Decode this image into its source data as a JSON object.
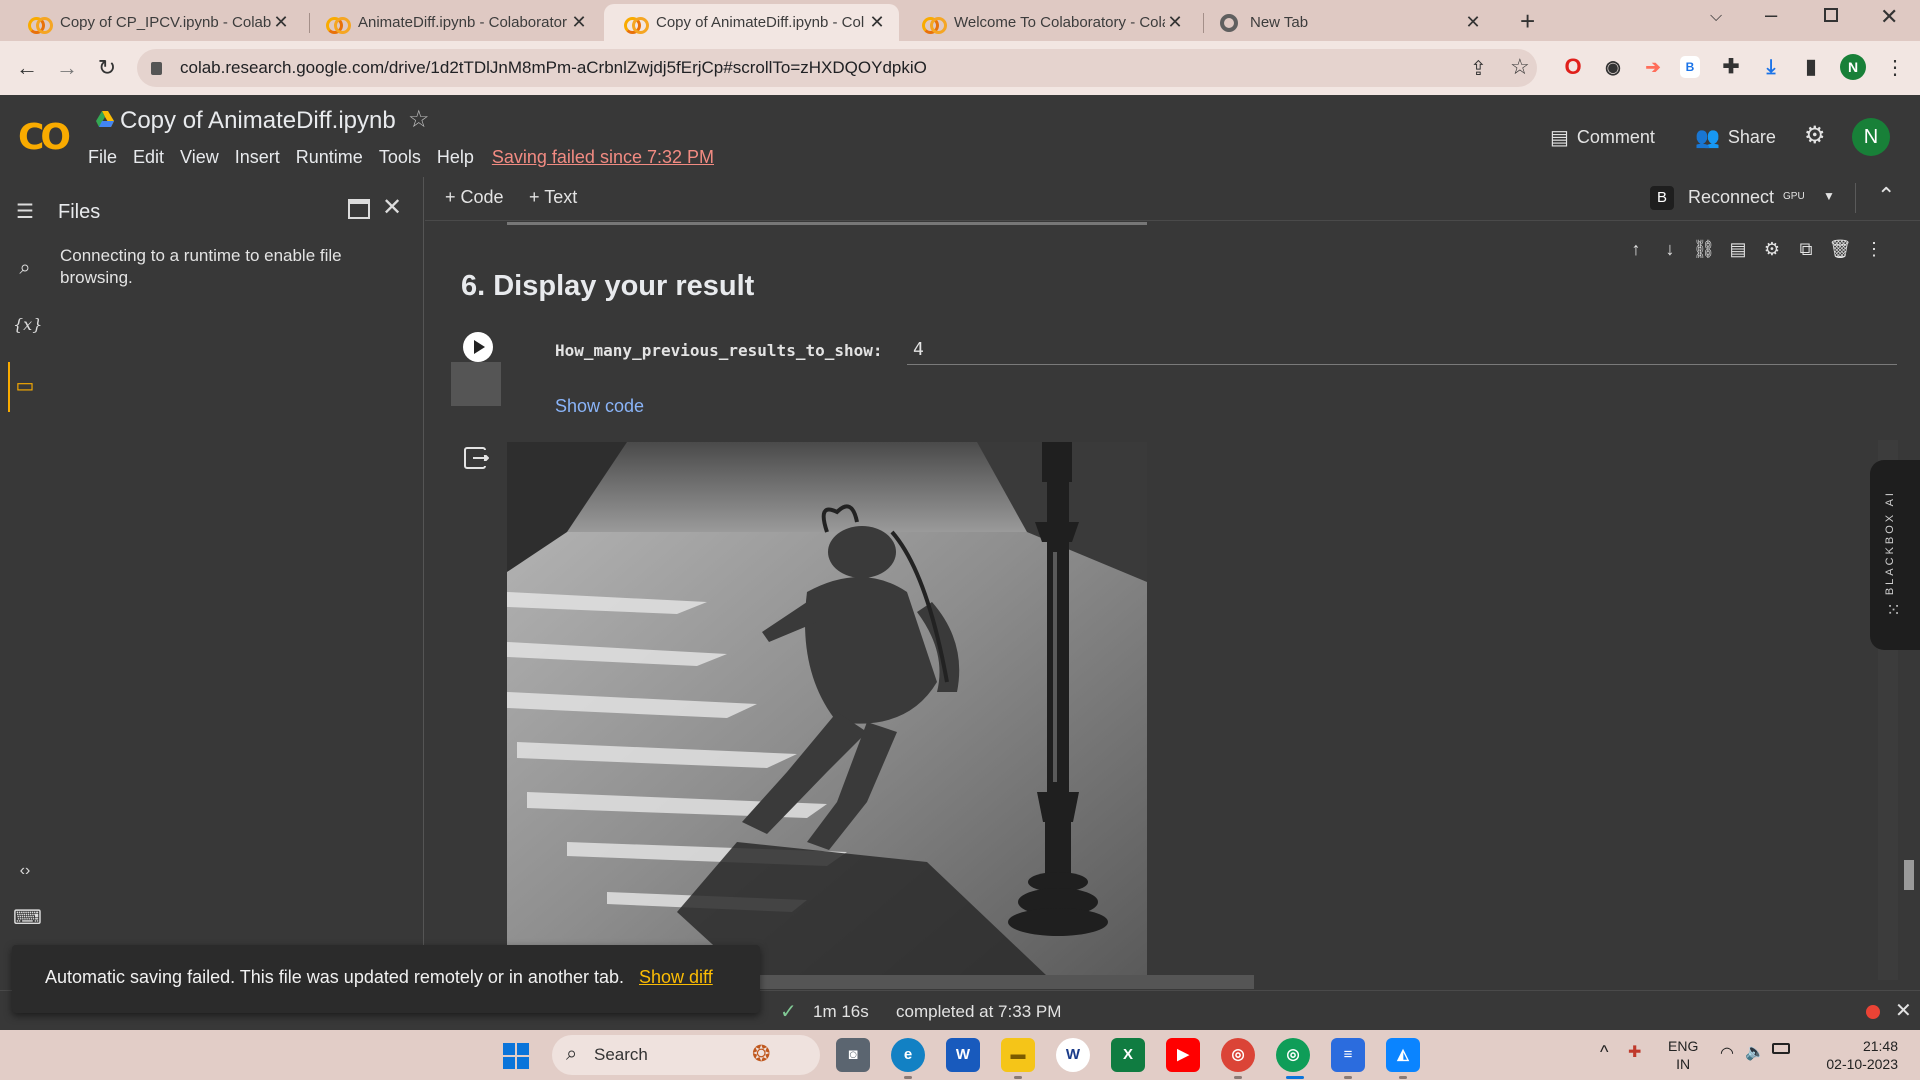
{
  "browser": {
    "tabs": [
      {
        "title": "Copy of CP_IPCV.ipynb - Colabo",
        "active": false
      },
      {
        "title": "AnimateDiff.ipynb - Colaborator",
        "active": false
      },
      {
        "title": "Copy of AnimateDiff.ipynb - Col",
        "active": true
      },
      {
        "title": "Welcome To Colaboratory - Cola",
        "active": false
      },
      {
        "title": "New Tab",
        "active": false
      }
    ],
    "url": "colab.research.google.com/drive/1d2tTDlJnM8mPm-aCrbnlZwjdj5fErjCp#scrollTo=zHXDQOYdpkiO",
    "profile_initial": "N"
  },
  "colab": {
    "logo_text": "CO",
    "notebook_title": "Copy of AnimateDiff.ipynb",
    "menu": [
      "File",
      "Edit",
      "View",
      "Insert",
      "Runtime",
      "Tools",
      "Help"
    ],
    "save_warning": "Saving failed since 7:32 PM",
    "comment_label": "Comment",
    "share_label": "Share",
    "avatar_initial": "N",
    "add_code": "+ Code",
    "add_text": "+ Text",
    "runtime_badge": "B",
    "reconnect_label": "Reconnect",
    "gpu_label": "GPU"
  },
  "files_panel": {
    "title": "Files",
    "message": "Connecting to a runtime to enable file browsing."
  },
  "cell": {
    "section_title": "6. Display your result",
    "param_label": "How_many_previous_results_to_show:",
    "param_value": "4",
    "show_code": "Show code"
  },
  "blackbox": {
    "label": "BLACKBOX AI"
  },
  "status": {
    "duration": "1m 16s",
    "completed": "completed at 7:33 PM"
  },
  "toast": {
    "message": "Automatic saving failed. This file was updated remotely or in another tab.",
    "link": "Show diff"
  },
  "taskbar": {
    "search_label": "Search",
    "lang_top": "ENG",
    "lang_bottom": "IN",
    "time": "21:48",
    "date": "02-10-2023"
  },
  "colors": {
    "accent": "#f9ab00",
    "link": "#8ab4f8",
    "warning": "#f28b82",
    "bg": "#383838"
  }
}
